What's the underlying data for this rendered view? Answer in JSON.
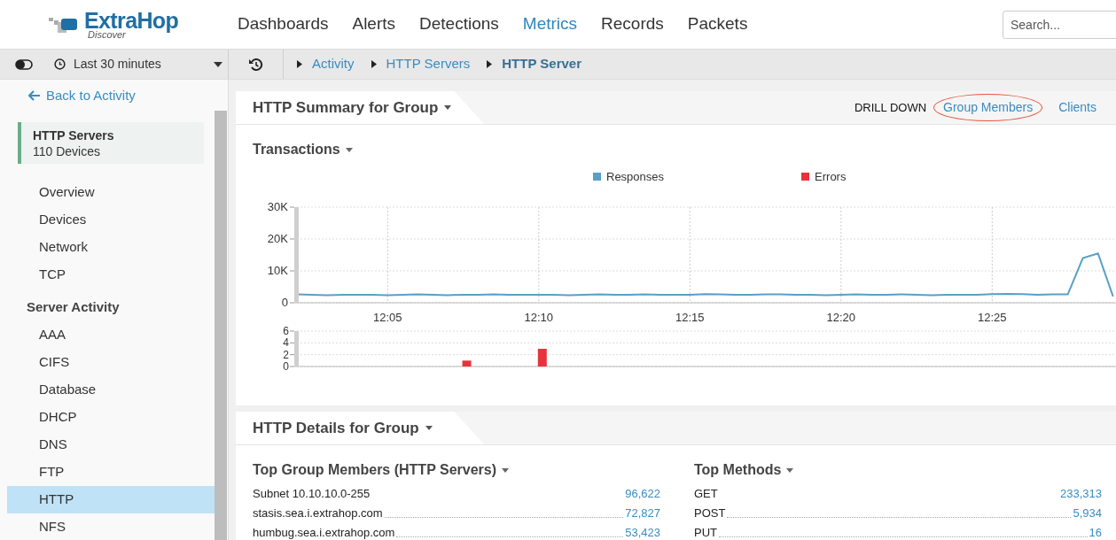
{
  "header": {
    "logo": {
      "name": "ExtraHop",
      "product": "Discover"
    },
    "nav": [
      {
        "label": "Dashboards",
        "selected": false
      },
      {
        "label": "Alerts",
        "selected": false
      },
      {
        "label": "Detections",
        "selected": false
      },
      {
        "label": "Metrics",
        "selected": true
      },
      {
        "label": "Records",
        "selected": false
      },
      {
        "label": "Packets",
        "selected": false
      }
    ],
    "search": {
      "placeholder": "Search..."
    }
  },
  "toolbar": {
    "time_range": "Last 30 minutes",
    "breadcrumbs": [
      {
        "label": "Activity",
        "current": false
      },
      {
        "label": "HTTP Servers",
        "current": false
      },
      {
        "label": "HTTP Server",
        "current": true
      }
    ]
  },
  "sidebar": {
    "back_link": "Back to Activity",
    "group": {
      "name": "HTTP Servers",
      "count": "110 Devices"
    },
    "items": [
      {
        "kind": "item",
        "label": "Overview",
        "selected": false
      },
      {
        "kind": "item",
        "label": "Devices",
        "selected": false
      },
      {
        "kind": "item",
        "label": "Network",
        "selected": false
      },
      {
        "kind": "item",
        "label": "TCP",
        "selected": false
      },
      {
        "kind": "heading",
        "label": "Server Activity"
      },
      {
        "kind": "item",
        "label": "AAA",
        "selected": false
      },
      {
        "kind": "item",
        "label": "CIFS",
        "selected": false
      },
      {
        "kind": "item",
        "label": "Database",
        "selected": false
      },
      {
        "kind": "item",
        "label": "DHCP",
        "selected": false
      },
      {
        "kind": "item",
        "label": "DNS",
        "selected": false
      },
      {
        "kind": "item",
        "label": "FTP",
        "selected": false
      },
      {
        "kind": "item",
        "label": "HTTP",
        "selected": true
      },
      {
        "kind": "item",
        "label": "NFS",
        "selected": false
      }
    ]
  },
  "summary_panel": {
    "title": "HTTP Summary for Group",
    "drill_down": {
      "label": "DRILL DOWN",
      "links": [
        {
          "label": "Group Members",
          "highlighted": true
        },
        {
          "label": "Clients",
          "highlighted": false
        }
      ]
    },
    "chart_title": "Transactions",
    "chart_data": {
      "type": "line",
      "categories": [
        null,
        null,
        null,
        null,
        null,
        null,
        "12:05",
        null,
        null,
        null,
        null,
        null,
        null,
        null,
        null,
        null,
        "12:10",
        null,
        null,
        null,
        null,
        null,
        null,
        null,
        null,
        null,
        "12:15",
        null,
        null,
        null,
        null,
        null,
        null,
        null,
        null,
        null,
        "12:20",
        null,
        null,
        null,
        null,
        null,
        null,
        null,
        null,
        null,
        "12:25",
        null,
        null,
        null,
        null,
        null,
        null,
        null,
        null
      ],
      "ylim": [
        0,
        30000
      ],
      "grid": true,
      "yticks": [
        {
          "value": 0,
          "label": "0"
        },
        {
          "value": 10000,
          "label": "10K"
        },
        {
          "value": 20000,
          "label": "20K"
        },
        {
          "value": 30000,
          "label": "30K"
        }
      ],
      "series": [
        {
          "name": "Responses",
          "color": "#5a9fc6",
          "values": [
            2600,
            2500,
            2400,
            2500,
            2500,
            2500,
            2400,
            2500,
            2600,
            2500,
            2400,
            2500,
            2500,
            2600,
            2500,
            2500,
            2500,
            2500,
            2400,
            2500,
            2600,
            2500,
            2500,
            2600,
            2500,
            2500,
            2500,
            2700,
            2600,
            2500,
            2500,
            2600,
            2600,
            2500,
            2500,
            2400,
            2500,
            2600,
            2500,
            2500,
            2600,
            2500,
            2400,
            2500,
            2500,
            2500,
            2700,
            2800,
            2700,
            2500,
            2600,
            2600,
            14000,
            15500,
            2000
          ]
        }
      ]
    },
    "errors_chart": {
      "chart_data": {
        "type": "bar",
        "categories": [
          null,
          null,
          null,
          null,
          null,
          null,
          null,
          null,
          null,
          null,
          null,
          null,
          null,
          null,
          null,
          null,
          null,
          null,
          null,
          null,
          null,
          null,
          null,
          null,
          null,
          null,
          null,
          null,
          null,
          null,
          null,
          null,
          null,
          null,
          null,
          null,
          null,
          null,
          null,
          null,
          null,
          null,
          null,
          null,
          null,
          null,
          null,
          null,
          null,
          null,
          null,
          null,
          null,
          null
        ],
        "ylim": [
          0,
          6
        ],
        "yticks": [
          0,
          2,
          4,
          6
        ],
        "series": [
          {
            "name": "Errors",
            "color": "#e8333c",
            "values": [
              null,
              null,
              null,
              null,
              null,
              null,
              null,
              null,
              null,
              null,
              null,
              1,
              null,
              null,
              null,
              null,
              3,
              null,
              null,
              null,
              null,
              null,
              null,
              null,
              null,
              null,
              null,
              null,
              null,
              null,
              null,
              null,
              null,
              null,
              null,
              null,
              null,
              null,
              null,
              null,
              null,
              null,
              null,
              null,
              null,
              null,
              null,
              null,
              null,
              null,
              null,
              null,
              null,
              null
            ]
          }
        ]
      }
    }
  },
  "details_panel": {
    "title": "HTTP Details for Group",
    "lists": [
      {
        "title": "Top Group Members (HTTP Servers)",
        "rows": [
          {
            "name": "Subnet 10.10.10.0-255",
            "value": "96,622",
            "dotted": false
          },
          {
            "name": "stasis.sea.i.extrahop.com",
            "value": "72,827",
            "dotted": true
          },
          {
            "name": "humbug.sea.i.extrahop.com",
            "value": "53,423",
            "dotted": true
          }
        ]
      },
      {
        "title": "Top Methods",
        "rows": [
          {
            "name": "GET",
            "value": "233,313",
            "dotted": false
          },
          {
            "name": "POST",
            "value": "5,934",
            "dotted": true
          },
          {
            "name": "PUT",
            "value": "16",
            "dotted": true
          }
        ]
      }
    ]
  }
}
